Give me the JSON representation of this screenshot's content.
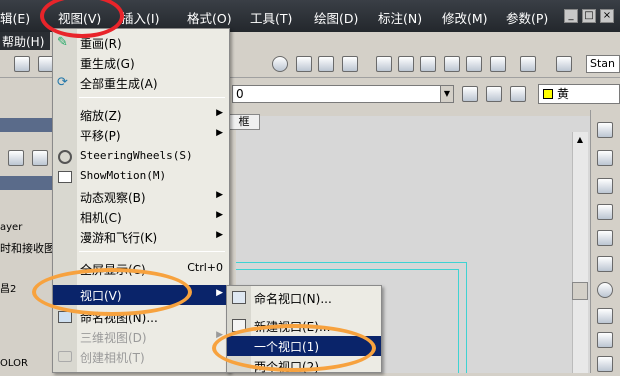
{
  "menubar": {
    "items": [
      {
        "label": "辑(E)"
      },
      {
        "label": "视图(V)"
      },
      {
        "label": "插入(I)"
      },
      {
        "label": "格式(O)"
      },
      {
        "label": "工具(T)"
      },
      {
        "label": "绘图(D)"
      },
      {
        "label": "标注(N)"
      },
      {
        "label": "修改(M)"
      },
      {
        "label": "参数(P)"
      }
    ],
    "row2_label": "帮助(H)"
  },
  "window_buttons": [
    "_",
    "□",
    "×"
  ],
  "toolbar_right_text": "Stan",
  "properties": {
    "combo_value": "0",
    "color_label": "黄",
    "color_value": "#ffff00"
  },
  "drawing_tab": "框",
  "left_panel": {
    "layer_text": "ayer",
    "row_text": "时和接收图",
    "num_text": "昌2",
    "bottom_text": "OLOR"
  },
  "view_menu": {
    "items": [
      {
        "label": "重画(R)",
        "icon": "redraw-icon"
      },
      {
        "label": "重生成(G)"
      },
      {
        "label": "全部重生成(A)",
        "icon": "regen-all-icon"
      },
      {
        "label": "缩放(Z)",
        "submenu": true
      },
      {
        "label": "平移(P)",
        "submenu": true
      },
      {
        "label": "SteeringWheels(S)",
        "icon": "steering-wheel-icon"
      },
      {
        "label": "ShowMotion(M)",
        "icon": "showmotion-icon"
      },
      {
        "label": "动态观察(B)",
        "submenu": true
      },
      {
        "label": "相机(C)",
        "submenu": true
      },
      {
        "label": "漫游和飞行(K)",
        "submenu": true
      },
      {
        "label": "全屏显示(C)",
        "shortcut": "Ctrl+0"
      },
      {
        "label": "视口(V)",
        "submenu": true,
        "highlighted": true
      },
      {
        "label": "命名视图(N)...",
        "icon": "named-view-icon"
      },
      {
        "label": "三维视图(D)",
        "submenu": true,
        "disabled": true
      },
      {
        "label": "创建相机(T)",
        "disabled": true,
        "icon": "camera-icon"
      }
    ]
  },
  "viewport_submenu": {
    "items": [
      {
        "label": "命名视口(N)...",
        "icon": "named-viewport-icon"
      },
      {
        "label": "新建视口(E)...",
        "icon": "new-viewport-icon"
      },
      {
        "label": "一个视口(1)",
        "highlighted": true
      },
      {
        "label": "两个视口(2)"
      }
    ]
  },
  "annotation_color": "#e8242a",
  "annotation_color2": "#f7a23e"
}
